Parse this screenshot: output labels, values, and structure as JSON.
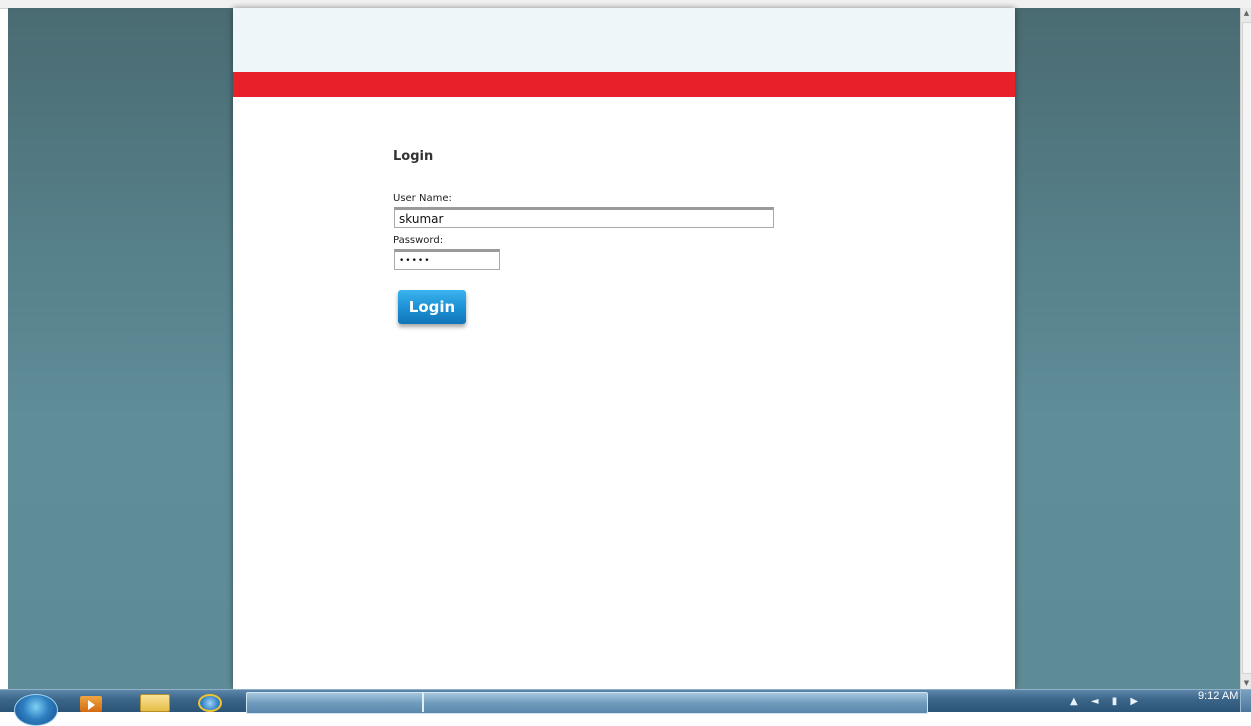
{
  "login_form": {
    "title": "Login",
    "username_label": "User Name:",
    "username_value": "skumar",
    "password_label": "Password:",
    "password_value": "•••••",
    "submit_label": "Login"
  },
  "colors": {
    "header_band": "#eef6f9",
    "red_bar": "#e8202a",
    "button_blue": "#1c8fd3",
    "desktop_teal": "#5e8c96"
  },
  "taskbar": {
    "pinned_icons": [
      "windows-start-orb",
      "media-player-icon",
      "folder-icon",
      "internet-explorer-icon"
    ],
    "clock": "9:12 AM"
  }
}
